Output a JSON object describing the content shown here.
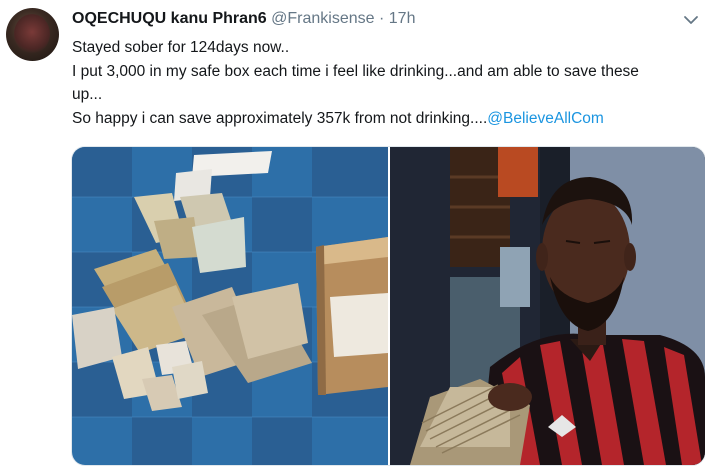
{
  "tweet": {
    "author_name": "OQECHUQU kanu Phran6",
    "author_handle": "@Frankisense",
    "separator": "·",
    "time": "17h",
    "lines": [
      "Stayed sober for 124days now..",
      "I put 3,000 in my safe box each time i feel like drinking...and am able to save these",
      "up...",
      "So happy i can save approximately  357k from not drinking...."
    ],
    "mention": "@BelieveAllCom"
  },
  "icons": {
    "menu": "chevron-down-icon"
  },
  "colors": {
    "link": "#1b95e0",
    "muted": "#657786",
    "text": "#14171a"
  }
}
